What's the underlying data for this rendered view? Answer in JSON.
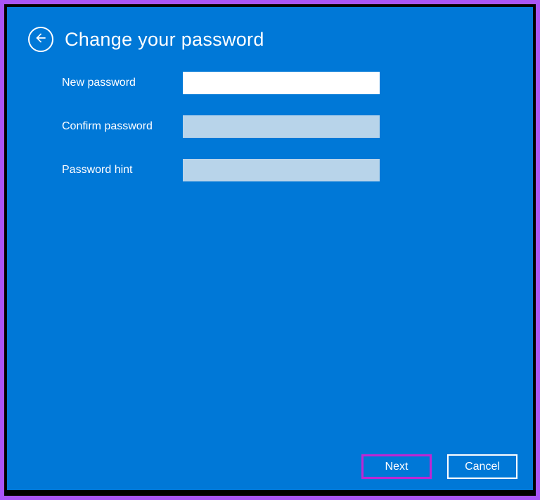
{
  "header": {
    "title": "Change your password"
  },
  "form": {
    "new_password": {
      "label": "New password",
      "value": ""
    },
    "confirm_password": {
      "label": "Confirm password",
      "value": ""
    },
    "password_hint": {
      "label": "Password hint",
      "value": ""
    }
  },
  "footer": {
    "next_label": "Next",
    "cancel_label": "Cancel"
  }
}
